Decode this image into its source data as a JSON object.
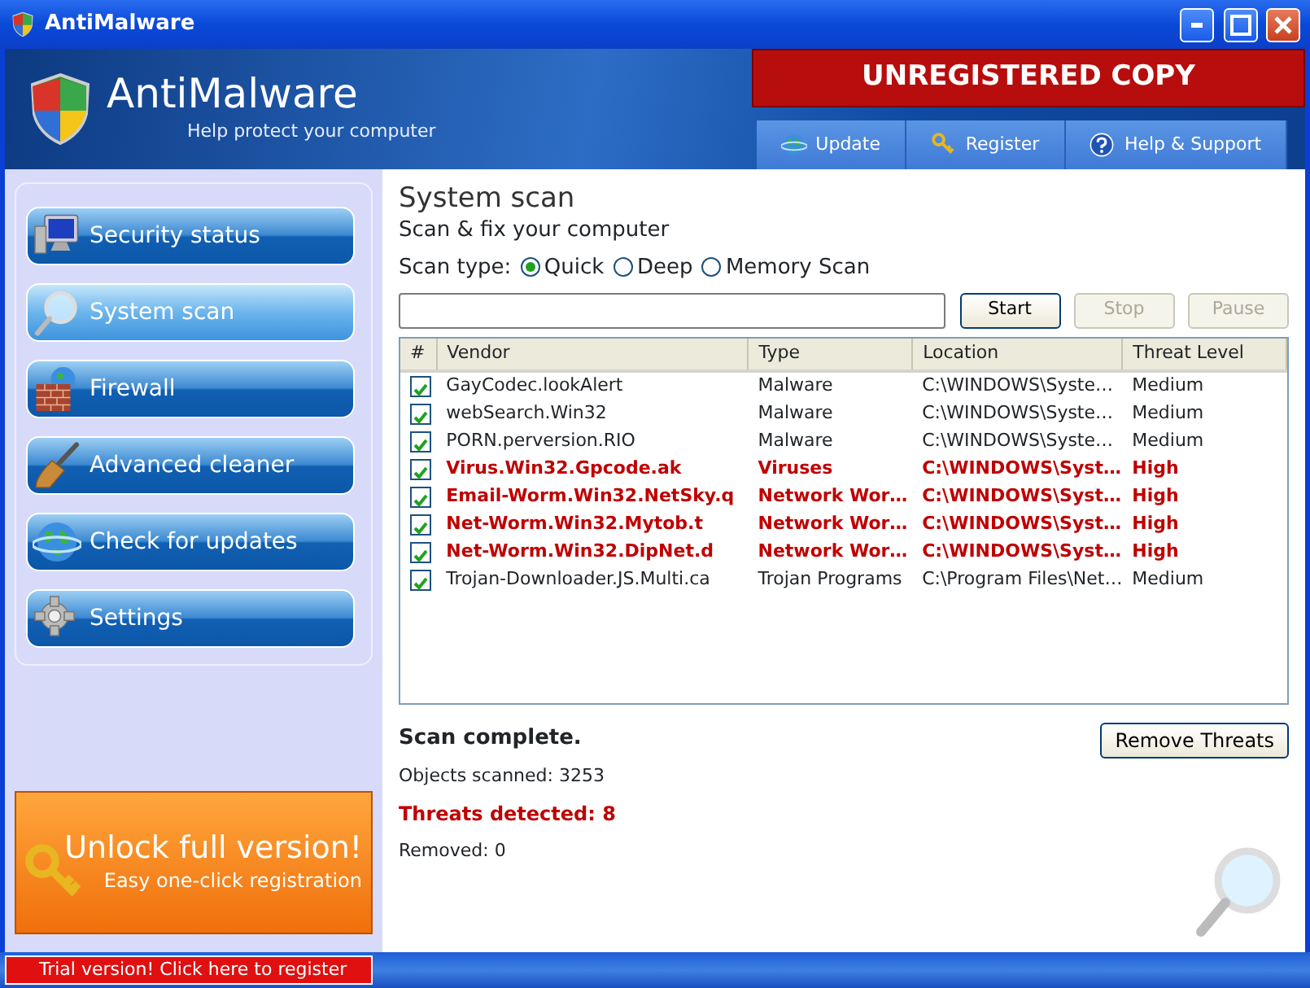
{
  "window": {
    "title": "AntiMalware"
  },
  "header": {
    "app_name": "AntiMalware",
    "tagline": "Help protect your computer",
    "banner": "UNREGISTERED COPY",
    "tabs": [
      {
        "label": "Update"
      },
      {
        "label": "Register"
      },
      {
        "label": "Help & Support"
      }
    ]
  },
  "sidebar": {
    "items": [
      {
        "label": "Security status",
        "selected": false
      },
      {
        "label": "System scan",
        "selected": true
      },
      {
        "label": "Firewall",
        "selected": false
      },
      {
        "label": "Advanced cleaner",
        "selected": false
      },
      {
        "label": "Check for updates",
        "selected": false
      },
      {
        "label": "Settings",
        "selected": false
      }
    ],
    "promo": {
      "title": "Unlock full version!",
      "subtitle": "Easy one-click registration"
    }
  },
  "main": {
    "title": "System scan",
    "subtitle": "Scan & fix your computer",
    "scan_type_label": "Scan type:",
    "scan_types": [
      {
        "label": "Quick",
        "selected": true
      },
      {
        "label": "Deep",
        "selected": false
      },
      {
        "label": "Memory Scan",
        "selected": false
      }
    ],
    "progress": {
      "level": 0
    },
    "buttons": [
      {
        "label": "Start",
        "disabled": false
      },
      {
        "label": "Stop",
        "disabled": true
      },
      {
        "label": "Pause",
        "disabled": true
      }
    ],
    "table": {
      "check_column": "#",
      "columns": [
        "Vendor",
        "Type",
        "Location",
        "Threat Level"
      ],
      "rows": [
        {
          "checked": true,
          "kind": "normal",
          "cells": [
            "GayCodec.lookAlert",
            "Malware",
            "C:\\WINDOWS\\Syste…",
            "Medium"
          ]
        },
        {
          "checked": true,
          "kind": "normal",
          "cells": [
            "webSearch.Win32",
            "Malware",
            "C:\\WINDOWS\\Syste…",
            "Medium"
          ]
        },
        {
          "checked": true,
          "kind": "normal",
          "cells": [
            "PORN.perversion.RIO",
            "Malware",
            "C:\\WINDOWS\\Syste…",
            "Medium"
          ]
        },
        {
          "checked": true,
          "kind": "high",
          "cells": [
            "Virus.Win32.Gpcode.ak",
            "Viruses",
            "C:\\WINDOWS\\Syst…",
            "High"
          ]
        },
        {
          "checked": true,
          "kind": "high",
          "cells": [
            "Email-Worm.Win32.NetSky.q",
            "Network Wor…",
            "C:\\WINDOWS\\Syst…",
            "High"
          ]
        },
        {
          "checked": true,
          "kind": "high",
          "cells": [
            "Net-Worm.Win32.Mytob.t",
            "Network Wor…",
            "C:\\WINDOWS\\Syst…",
            "High"
          ]
        },
        {
          "checked": true,
          "kind": "high",
          "cells": [
            "Net-Worm.Win32.DipNet.d",
            "Network Wor…",
            "C:\\WINDOWS\\Syst…",
            "High"
          ]
        },
        {
          "checked": true,
          "kind": "normal",
          "cells": [
            "Trojan-Downloader.JS.Multi.ca",
            "Trojan Programs",
            "C:\\Program Files\\Net…",
            "Medium"
          ]
        }
      ]
    },
    "summary": {
      "status": "Scan complete.",
      "objects": "Objects scanned: 3253",
      "threats": "Threats detected: 8",
      "removed": "Removed: 0"
    },
    "remove_button": "Remove Threats"
  },
  "status_bar": {
    "trial_link": "Trial version! Click here to register"
  }
}
